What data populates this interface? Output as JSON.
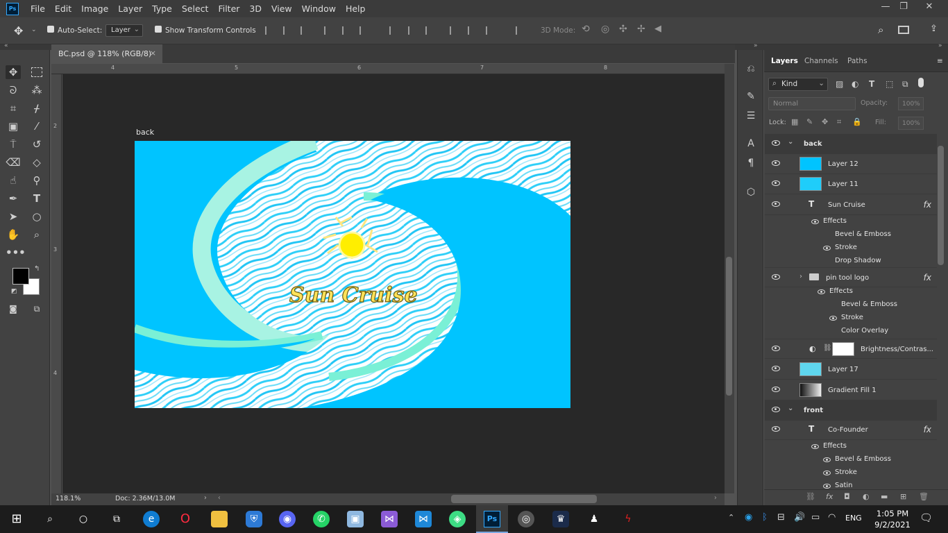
{
  "app": {
    "logo": "Ps",
    "menu": [
      "File",
      "Edit",
      "Image",
      "Layer",
      "Type",
      "Select",
      "Filter",
      "3D",
      "View",
      "Window",
      "Help"
    ],
    "window_controls": [
      "—",
      "❐",
      "✕"
    ]
  },
  "options": {
    "auto_select_label": "Auto-Select:",
    "auto_select_value": "Layer",
    "transform_label": "Show Transform Controls",
    "mode_3d_label": "3D Mode:"
  },
  "document": {
    "tab_title": "BC.psd @ 118% (RGB/8)",
    "tab_close": "×",
    "artboard_name": "back",
    "ruler_top": [
      "4",
      "5",
      "6",
      "7",
      "8"
    ],
    "ruler_left": [
      "2",
      "3",
      "4"
    ],
    "zoom": "118.1%",
    "doc_info": "Doc: 2.36M/13.0M",
    "artwork_title": "Sun Cruise"
  },
  "layers_panel": {
    "tabs": [
      "Layers",
      "Channels",
      "Paths"
    ],
    "kind_label": "Kind",
    "blend_mode": "Normal",
    "opacity_label": "Opacity:",
    "opacity_value": "100%",
    "lock_label": "Lock:",
    "fill_label": "Fill:",
    "fill_value": "100%",
    "rows": {
      "back": "back",
      "layer12": "Layer 12",
      "layer11": "Layer 11",
      "sun_cruise": "Sun Cruise",
      "effects1": "Effects",
      "bevel1": "Bevel & Emboss",
      "stroke1": "Stroke",
      "drop_shadow": "Drop Shadow",
      "pin_tool_logo": "pin tool logo",
      "effects2": "Effects",
      "bevel2": "Bevel & Emboss",
      "stroke2": "Stroke",
      "color_overlay": "Color Overlay",
      "brightness": "Brightness/Contras...",
      "layer17": "Layer 17",
      "gradient": "Gradient Fill 1",
      "front": "front",
      "cofounder": "Co-Founder",
      "effects3": "Effects",
      "bevel3": "Bevel & Emboss",
      "stroke3": "Stroke",
      "satin": "Satin"
    },
    "fx_label": "fx"
  },
  "taskbar": {
    "time": "1:05 PM",
    "date": "9/2/2021",
    "lang": "ENG",
    "ps_label": "Ps"
  },
  "colors": {
    "accent": "#31a8ff",
    "artboard_blue": "#00c4ff",
    "wave_mint": "#7af0d6",
    "sun_yellow": "#ffee00"
  }
}
